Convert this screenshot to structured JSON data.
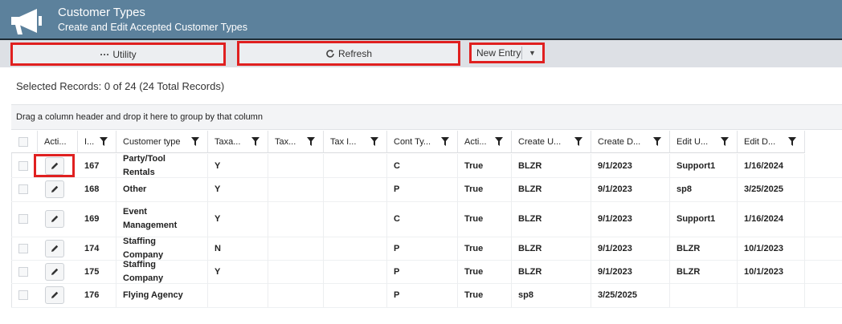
{
  "header": {
    "title": "Customer Types",
    "subtitle": "Create and Edit Accepted Customer Types",
    "icon": "megaphone-icon"
  },
  "toolbar": {
    "utility_label": "Utility",
    "refresh_label": "Refresh",
    "new_entry_label": "New Entry",
    "highlight_color": "#e02020"
  },
  "selection": {
    "text": "Selected Records: 0 of 24 (24 Total Records)"
  },
  "group_panel": {
    "text": "Drag a column header and drop it here to group by that column"
  },
  "columns": [
    "Acti...",
    "I...",
    "Customer type",
    "Taxa...",
    "Tax...",
    "Tax I...",
    "Cont Ty...",
    "Acti...",
    "Create U...",
    "Create D...",
    "Edit U...",
    "Edit D..."
  ],
  "rows": [
    {
      "id": "167",
      "customer_type": "Party/Tool Rentals",
      "taxable": "Y",
      "tax2": "",
      "tax_id": "",
      "cont_type": "C",
      "active": "True",
      "create_user": "BLZR",
      "create_date": "9/1/2023",
      "edit_user": "Support1",
      "edit_date": "1/16/2024"
    },
    {
      "id": "168",
      "customer_type": "Other",
      "taxable": "Y",
      "tax2": "",
      "tax_id": "",
      "cont_type": "P",
      "active": "True",
      "create_user": "BLZR",
      "create_date": "9/1/2023",
      "edit_user": "sp8",
      "edit_date": "3/25/2025"
    },
    {
      "id": "169",
      "customer_type": "Event Management",
      "taxable": "Y",
      "tax2": "",
      "tax_id": "",
      "cont_type": "C",
      "active": "True",
      "create_user": "BLZR",
      "create_date": "9/1/2023",
      "edit_user": "Support1",
      "edit_date": "1/16/2024"
    },
    {
      "id": "174",
      "customer_type": "Staffing Company",
      "taxable": "N",
      "tax2": "",
      "tax_id": "",
      "cont_type": "P",
      "active": "True",
      "create_user": "BLZR",
      "create_date": "9/1/2023",
      "edit_user": "BLZR",
      "edit_date": "10/1/2023"
    },
    {
      "id": "175",
      "customer_type": "Staffing Company",
      "taxable": "Y",
      "tax2": "",
      "tax_id": "",
      "cont_type": "P",
      "active": "True",
      "create_user": "BLZR",
      "create_date": "9/1/2023",
      "edit_user": "BLZR",
      "edit_date": "10/1/2023"
    },
    {
      "id": "176",
      "customer_type": "Flying Agency",
      "taxable": "",
      "tax2": "",
      "tax_id": "",
      "cont_type": "P",
      "active": "True",
      "create_user": "sp8",
      "create_date": "3/25/2025",
      "edit_user": "",
      "edit_date": ""
    }
  ]
}
